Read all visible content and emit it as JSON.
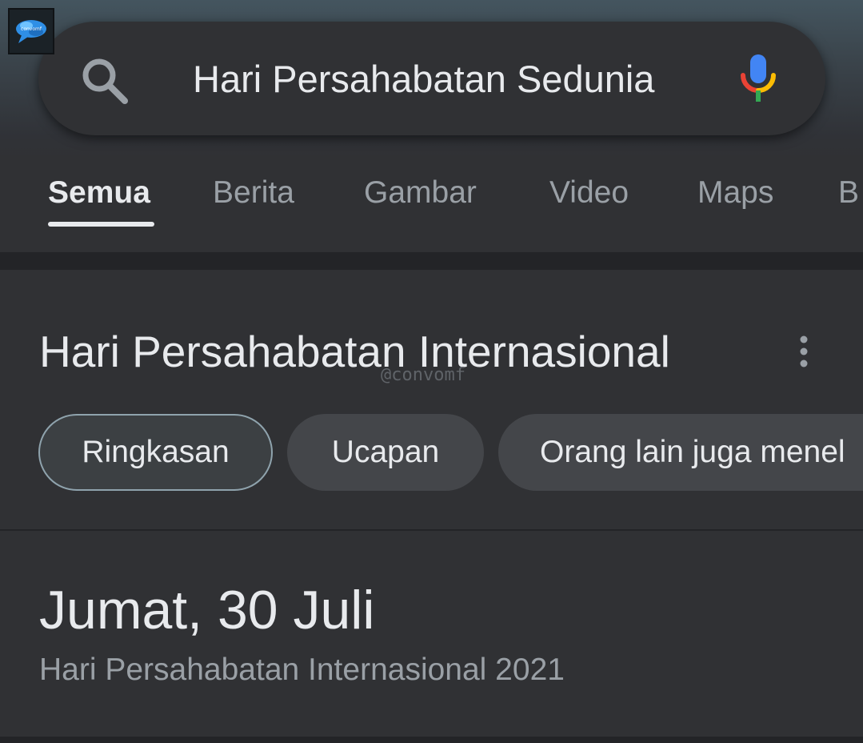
{
  "logo": {
    "icon": "convomf-logo-icon",
    "text": "convomf"
  },
  "search": {
    "icon": "search-icon",
    "query": "Hari Persahabatan Sedunia",
    "mic_icon": "mic-icon"
  },
  "tabs": [
    {
      "label": "Semua",
      "active": true
    },
    {
      "label": "Berita",
      "active": false
    },
    {
      "label": "Gambar",
      "active": false
    },
    {
      "label": "Video",
      "active": false
    },
    {
      "label": "Maps",
      "active": false
    },
    {
      "label": "B",
      "active": false
    }
  ],
  "card": {
    "title": "Hari Persahabatan Internasional",
    "menu_icon": "more-vert-icon",
    "watermark": "@convomf",
    "chips": [
      {
        "label": "Ringkasan",
        "selected": true
      },
      {
        "label": "Ucapan",
        "selected": false
      },
      {
        "label": "Orang lain juga menel",
        "selected": false
      }
    ]
  },
  "answer": {
    "date": "Jumat, 30 Juli",
    "subtitle": "Hari Persahabatan Internasional 2021"
  },
  "colors": {
    "background": "#303134",
    "text_primary": "#e8eaed",
    "text_secondary": "#9aa0a6",
    "chip_bg": "#44464a",
    "chip_selected_border": "#8fa3ad",
    "mic_blue": "#4285f4",
    "mic_red": "#ea4335",
    "mic_yellow": "#fbbc04",
    "mic_green": "#34a853"
  }
}
